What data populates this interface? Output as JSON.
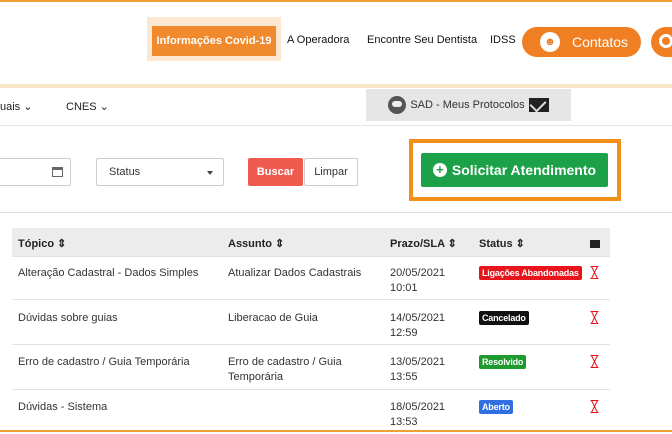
{
  "header": {
    "nav": {
      "covid": "Informações Covid-19",
      "operadora": "A Operadora",
      "dentista": "Encontre Seu Dentista",
      "idss": "IDSS",
      "contatos": "Contatos"
    }
  },
  "submenu": {
    "item_manuais": "uais",
    "item_cnes": "CNES",
    "sad_tab": "SAD - Meus Protocolos"
  },
  "filters": {
    "status_label": "Status",
    "buscar": "Buscar",
    "limpar": "Limpar",
    "solicitar": "Solicitar Atendimento"
  },
  "table": {
    "headers": {
      "topico": "Tópico ⇕",
      "assunto": "Assunto ⇕",
      "prazo": "Prazo/SLA ⇕",
      "status": "Status ⇕"
    },
    "rows": [
      {
        "topico": "Alteração Cadastral - Dados Simples",
        "assunto": "Atualizar Dados Cadastrais",
        "prazo_date": "20/05/2021",
        "prazo_time": "10:01",
        "status": "Ligações Abandonadas"
      },
      {
        "topico": "Dúvidas sobre guias",
        "assunto": "Liberacao de Guia",
        "prazo_date": "14/05/2021",
        "prazo_time": "12:59",
        "status": "Cancelado"
      },
      {
        "topico": "Erro de cadastro / Guia Temporária",
        "assunto": "Erro de cadastro / Guia",
        "assunto2": "Temporária",
        "prazo_date": "13/05/2021",
        "prazo_time": "13:55",
        "status": "Resolvido"
      },
      {
        "topico": "Dúvidas - Sistema",
        "assunto": "",
        "prazo_date": "18/05/2021",
        "prazo_time": "13:53",
        "status": "Aberto"
      }
    ]
  },
  "colors": {
    "accent": "#f07f24",
    "success": "#1ca149",
    "danger": "#e8141c",
    "status_cancelado": "#111111",
    "status_resolvido": "#1e9a2e",
    "status_aberto": "#2f6fe0"
  }
}
